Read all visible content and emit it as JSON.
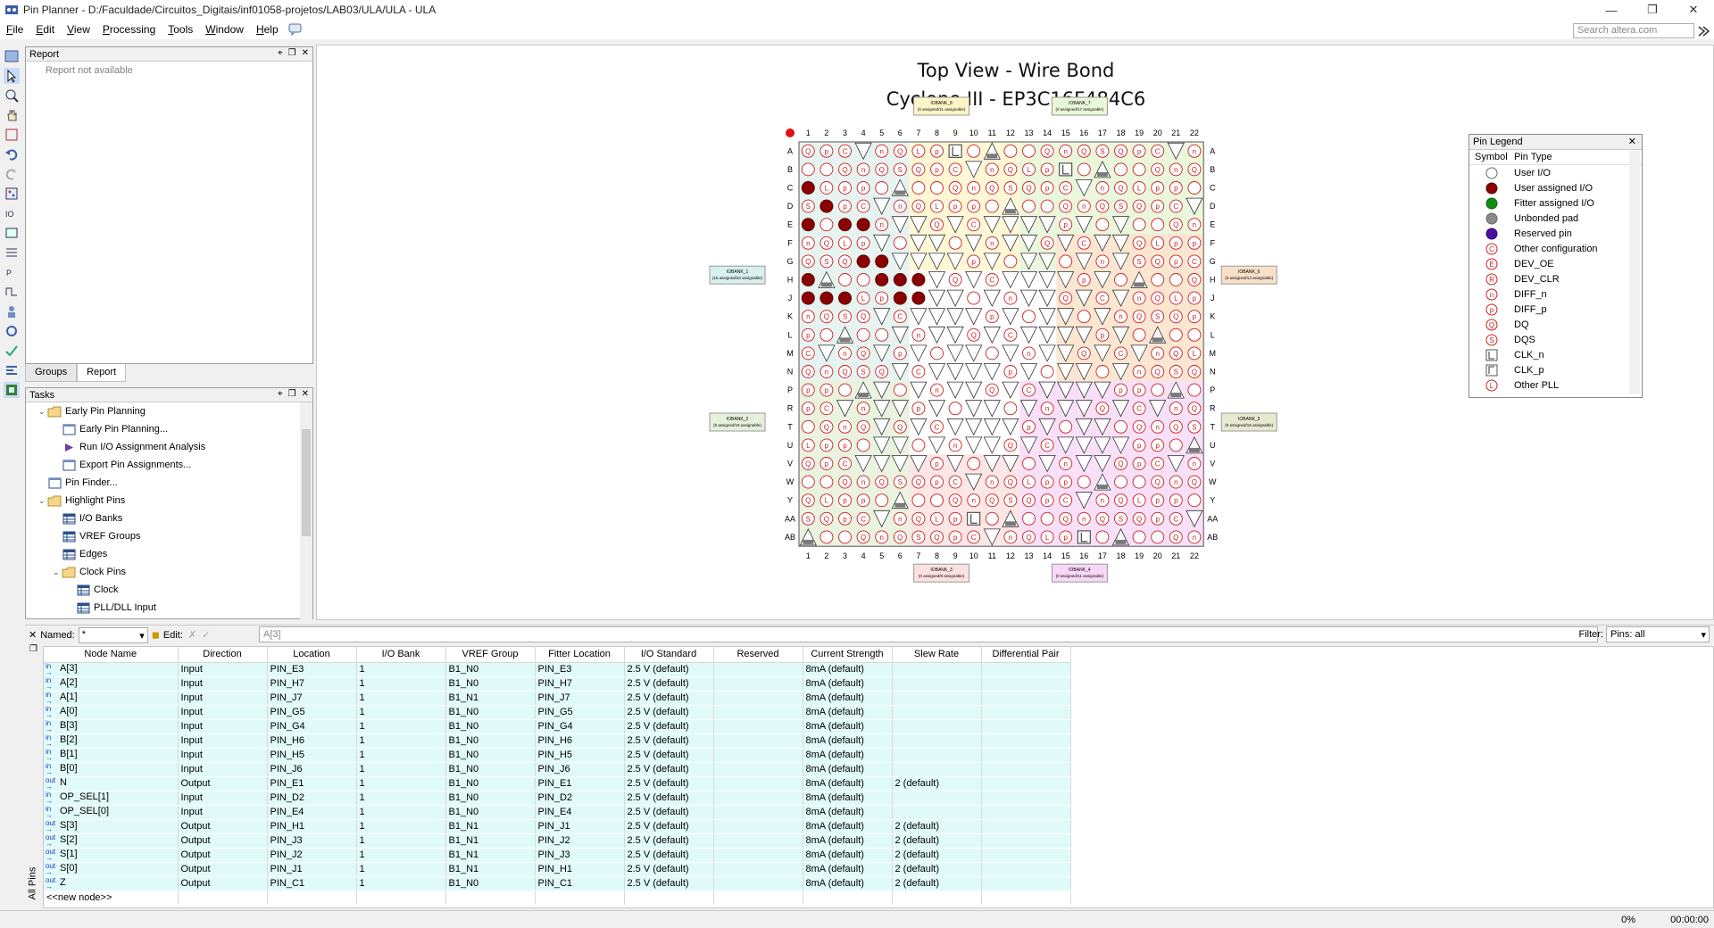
{
  "window": {
    "title": "Pin Planner - D:/Faculdade/Circuitos_Digitais/inf01058-projetos/LAB03/ULA/ULA - ULA"
  },
  "menu": [
    "File",
    "Edit",
    "View",
    "Processing",
    "Tools",
    "Window",
    "Help"
  ],
  "search": {
    "placeholder": "Search altera.com"
  },
  "report_panel": {
    "title": "Report",
    "message": "Report not available"
  },
  "bottom_tabs": [
    "Groups",
    "Report"
  ],
  "tasks_panel": {
    "title": "Tasks",
    "items": [
      {
        "label": "Early Pin Planning",
        "indent": 1,
        "expander": "⌄",
        "icon": "folder-icon"
      },
      {
        "label": "Early Pin Planning...",
        "indent": 2,
        "icon": "window-icon"
      },
      {
        "label": "Run I/O Assignment Analysis",
        "indent": 2,
        "icon": "play-icon"
      },
      {
        "label": "Export Pin Assignments...",
        "indent": 2,
        "icon": "window-icon"
      },
      {
        "label": "Pin Finder...",
        "indent": 1,
        "icon": "window-icon"
      },
      {
        "label": "Highlight Pins",
        "indent": 1,
        "expander": "⌄",
        "icon": "folder-icon"
      },
      {
        "label": "I/O Banks",
        "indent": 2,
        "icon": "table-icon"
      },
      {
        "label": "VREF Groups",
        "indent": 2,
        "icon": "table-icon"
      },
      {
        "label": "Edges",
        "indent": 2,
        "icon": "table-icon"
      },
      {
        "label": "Clock Pins",
        "indent": 2,
        "expander": "⌄",
        "icon": "folder-icon"
      },
      {
        "label": "Clock",
        "indent": 3,
        "icon": "table-icon"
      },
      {
        "label": "PLL/DLL Input",
        "indent": 3,
        "icon": "table-icon"
      }
    ]
  },
  "view": {
    "title1": "Top View - Wire Bond",
    "title2": "Cyclone III - EP3C16F484C6"
  },
  "package": {
    "cols": [
      "1",
      "2",
      "3",
      "4",
      "5",
      "6",
      "7",
      "8",
      "9",
      "10",
      "11",
      "12",
      "13",
      "14",
      "15",
      "16",
      "17",
      "18",
      "19",
      "20",
      "21",
      "22"
    ],
    "rows": [
      "A",
      "B",
      "C",
      "D",
      "E",
      "F",
      "G",
      "H",
      "J",
      "K",
      "L",
      "M",
      "N",
      "P",
      "R",
      "T",
      "U",
      "V",
      "W",
      "Y",
      "AA",
      "AB"
    ],
    "user_assigned": [
      "E3",
      "H7",
      "J7",
      "G5",
      "G4",
      "H6",
      "H5",
      "J6",
      "E1",
      "D2",
      "E4",
      "J1",
      "J3",
      "J2",
      "H1",
      "C1"
    ],
    "banks": [
      {
        "label": "IOBANK_8",
        "sub": "(0 assigned/11 assignable)",
        "pos": "top-left",
        "color": "#fff6c8"
      },
      {
        "label": "IOBANK_7",
        "sub": "(0 assigned/17 assignable)",
        "pos": "top-right",
        "color": "#e8f8d8"
      },
      {
        "label": "IOBANK_1",
        "sub": "(16 assigned/33 assignable)",
        "pos": "left-top",
        "color": "#d8f0ee"
      },
      {
        "label": "IOBANK_2",
        "sub": "(0 assigned/16 assignable)",
        "pos": "left-bottom",
        "color": "#e6f0da"
      },
      {
        "label": "IOBANK_6",
        "sub": "(0 assigned/13 assignable)",
        "pos": "right-top",
        "color": "#f8e0c8"
      },
      {
        "label": "IOBANK_5",
        "sub": "(0 assigned/16 assignable)",
        "pos": "right-bottom",
        "color": "#e8ead0"
      },
      {
        "label": "IOBANK_3",
        "sub": "(0 assigned/8 assignable)",
        "pos": "bottom-left",
        "color": "#fde0e0"
      },
      {
        "label": "IOBANK_4",
        "sub": "(0 assigned/11 assignable)",
        "pos": "bottom-right",
        "color": "#f8d8f8"
      }
    ]
  },
  "legend": {
    "title": "Pin Legend",
    "columns": [
      "Symbol",
      "Pin Type"
    ],
    "items": [
      {
        "label": "User I/O",
        "kind": "circle",
        "fill": "#ffffff",
        "stroke": "#666666",
        "letter": ""
      },
      {
        "label": "User assigned I/O",
        "kind": "circle",
        "fill": "#8b0000",
        "stroke": "#6b0000",
        "letter": ""
      },
      {
        "label": "Fitter assigned I/O",
        "kind": "circle",
        "fill": "#138a13",
        "stroke": "#0b6b0b",
        "letter": ""
      },
      {
        "label": "Unbonded pad",
        "kind": "circle",
        "fill": "#8a8a8a",
        "stroke": "#666666",
        "letter": ""
      },
      {
        "label": "Reserved pin",
        "kind": "circle",
        "fill": "#4b0fa0",
        "stroke": "#350878",
        "letter": ""
      },
      {
        "label": "Other configuration",
        "kind": "circle",
        "fill": "#ffffff",
        "stroke": "#cc2222",
        "letter": "C"
      },
      {
        "label": "DEV_OE",
        "kind": "circle",
        "fill": "#ffffff",
        "stroke": "#cc2222",
        "letter": "E"
      },
      {
        "label": "DEV_CLR",
        "kind": "circle",
        "fill": "#ffffff",
        "stroke": "#cc2222",
        "letter": "R"
      },
      {
        "label": "DIFF_n",
        "kind": "circle",
        "fill": "#ffffff",
        "stroke": "#cc2222",
        "letter": "n"
      },
      {
        "label": "DIFF_p",
        "kind": "circle",
        "fill": "#ffffff",
        "stroke": "#cc2222",
        "letter": "p"
      },
      {
        "label": "DQ",
        "kind": "circle",
        "fill": "#ffffff",
        "stroke": "#cc2222",
        "letter": "Q"
      },
      {
        "label": "DQS",
        "kind": "circle",
        "fill": "#ffffff",
        "stroke": "#cc2222",
        "letter": "S"
      },
      {
        "label": "CLK_n",
        "kind": "clkn",
        "fill": "#ffffff",
        "stroke": "#555555",
        "letter": ""
      },
      {
        "label": "CLK_p",
        "kind": "clkp",
        "fill": "#ffffff",
        "stroke": "#555555",
        "letter": ""
      },
      {
        "label": "Other PLL",
        "kind": "circle",
        "fill": "#ffffff",
        "stroke": "#cc2222",
        "letter": "L"
      }
    ]
  },
  "filter_bar": {
    "named_label": "Named:",
    "named_value": "*",
    "edit_label": "Edit:",
    "edit_value": "A[3]",
    "filter_label": "Filter:",
    "filter_value": "Pins: all"
  },
  "all_pins_label": "All Pins",
  "pin_table": {
    "columns": [
      "Node Name",
      "Direction",
      "Location",
      "I/O Bank",
      "VREF Group",
      "Fitter Location",
      "I/O Standard",
      "Reserved",
      "Current Strength",
      "Slew Rate",
      "Differential Pair"
    ],
    "rows": [
      {
        "dir_icon": "in",
        "cells": [
          "A[3]",
          "Input",
          "PIN_E3",
          "1",
          "B1_N0",
          "PIN_E3",
          "2.5 V (default)",
          "",
          "8mA (default)",
          "",
          ""
        ]
      },
      {
        "dir_icon": "in",
        "cells": [
          "A[2]",
          "Input",
          "PIN_H7",
          "1",
          "B1_N0",
          "PIN_H7",
          "2.5 V (default)",
          "",
          "8mA (default)",
          "",
          ""
        ]
      },
      {
        "dir_icon": "in",
        "cells": [
          "A[1]",
          "Input",
          "PIN_J7",
          "1",
          "B1_N1",
          "PIN_J7",
          "2.5 V (default)",
          "",
          "8mA (default)",
          "",
          ""
        ]
      },
      {
        "dir_icon": "in",
        "cells": [
          "A[0]",
          "Input",
          "PIN_G5",
          "1",
          "B1_N0",
          "PIN_G5",
          "2.5 V (default)",
          "",
          "8mA (default)",
          "",
          ""
        ]
      },
      {
        "dir_icon": "in",
        "cells": [
          "B[3]",
          "Input",
          "PIN_G4",
          "1",
          "B1_N0",
          "PIN_G4",
          "2.5 V (default)",
          "",
          "8mA (default)",
          "",
          ""
        ]
      },
      {
        "dir_icon": "in",
        "cells": [
          "B[2]",
          "Input",
          "PIN_H6",
          "1",
          "B1_N0",
          "PIN_H6",
          "2.5 V (default)",
          "",
          "8mA (default)",
          "",
          ""
        ]
      },
      {
        "dir_icon": "in",
        "cells": [
          "B[1]",
          "Input",
          "PIN_H5",
          "1",
          "B1_N0",
          "PIN_H5",
          "2.5 V (default)",
          "",
          "8mA (default)",
          "",
          ""
        ]
      },
      {
        "dir_icon": "in",
        "cells": [
          "B[0]",
          "Input",
          "PIN_J6",
          "1",
          "B1_N0",
          "PIN_J6",
          "2.5 V (default)",
          "",
          "8mA (default)",
          "",
          ""
        ]
      },
      {
        "dir_icon": "out",
        "cells": [
          "N",
          "Output",
          "PIN_E1",
          "1",
          "B1_N0",
          "PIN_E1",
          "2.5 V (default)",
          "",
          "8mA (default)",
          "2 (default)",
          ""
        ]
      },
      {
        "dir_icon": "in",
        "cells": [
          "OP_SEL[1]",
          "Input",
          "PIN_D2",
          "1",
          "B1_N0",
          "PIN_D2",
          "2.5 V (default)",
          "",
          "8mA (default)",
          "",
          ""
        ]
      },
      {
        "dir_icon": "in",
        "cells": [
          "OP_SEL[0]",
          "Input",
          "PIN_E4",
          "1",
          "B1_N0",
          "PIN_E4",
          "2.5 V (default)",
          "",
          "8mA (default)",
          "",
          ""
        ]
      },
      {
        "dir_icon": "out",
        "cells": [
          "S[3]",
          "Output",
          "PIN_H1",
          "1",
          "B1_N1",
          "PIN_J1",
          "2.5 V (default)",
          "",
          "8mA (default)",
          "2 (default)",
          ""
        ]
      },
      {
        "dir_icon": "out",
        "cells": [
          "S[2]",
          "Output",
          "PIN_J3",
          "1",
          "B1_N1",
          "PIN_J2",
          "2.5 V (default)",
          "",
          "8mA (default)",
          "2 (default)",
          ""
        ]
      },
      {
        "dir_icon": "out",
        "cells": [
          "S[1]",
          "Output",
          "PIN_J2",
          "1",
          "B1_N1",
          "PIN_J3",
          "2.5 V (default)",
          "",
          "8mA (default)",
          "2 (default)",
          ""
        ]
      },
      {
        "dir_icon": "out",
        "cells": [
          "S[0]",
          "Output",
          "PIN_J1",
          "1",
          "B1_N1",
          "PIN_H1",
          "2.5 V (default)",
          "",
          "8mA (default)",
          "2 (default)",
          ""
        ]
      },
      {
        "dir_icon": "out",
        "cells": [
          "Z",
          "Output",
          "PIN_C1",
          "1",
          "B1_N0",
          "PIN_C1",
          "2.5 V (default)",
          "",
          "8mA (default)",
          "2 (default)",
          ""
        ]
      }
    ],
    "new_node": "<<new node>>"
  },
  "status": {
    "progress": "0%",
    "time": "00:00:00"
  }
}
